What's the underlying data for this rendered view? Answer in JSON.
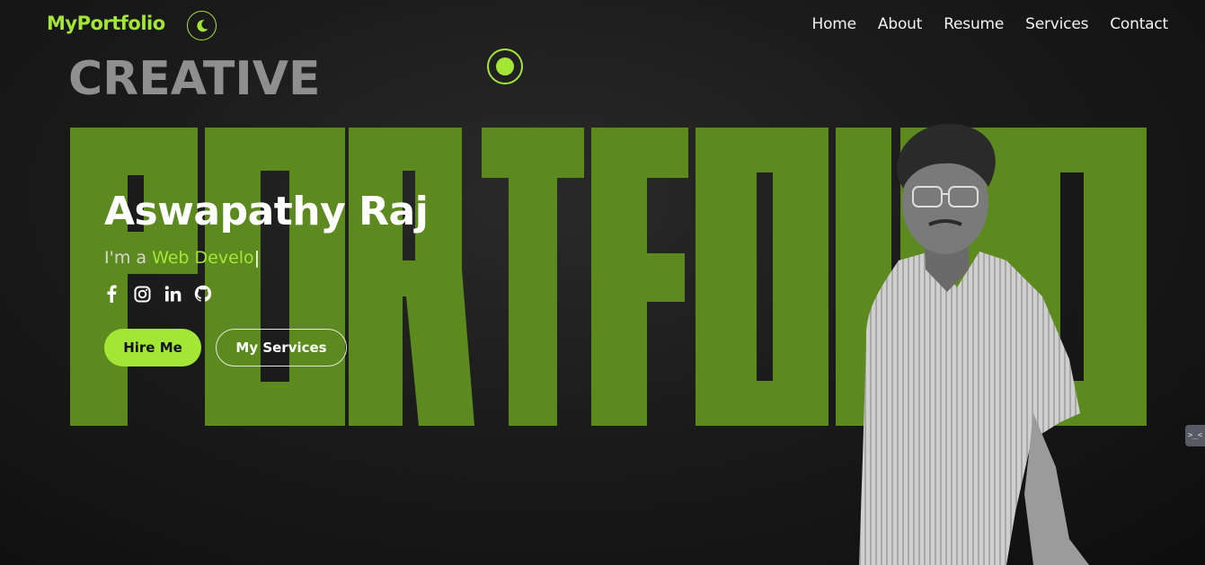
{
  "header": {
    "logo": "MyPortfolio",
    "theme_toggle_icon": "moon-icon",
    "nav": [
      "Home",
      "About",
      "Resume",
      "Services",
      "Contact"
    ]
  },
  "hero": {
    "eyebrow": "CREATIVE",
    "background_word": "PORTFOLIO",
    "name": "Aswapathy Raj",
    "tagline_prefix": "I'm a ",
    "tagline_role": "Web Develo",
    "tagline_caret": "|",
    "socials": [
      "facebook-icon",
      "instagram-icon",
      "linkedin-icon",
      "github-icon"
    ],
    "primary_button": "Hire Me",
    "secondary_button": "My Services"
  },
  "side_widget": {
    "label": ">_<"
  },
  "colors": {
    "accent": "#a3e635",
    "background_word": "#5d8a1e",
    "background": "#141414"
  }
}
